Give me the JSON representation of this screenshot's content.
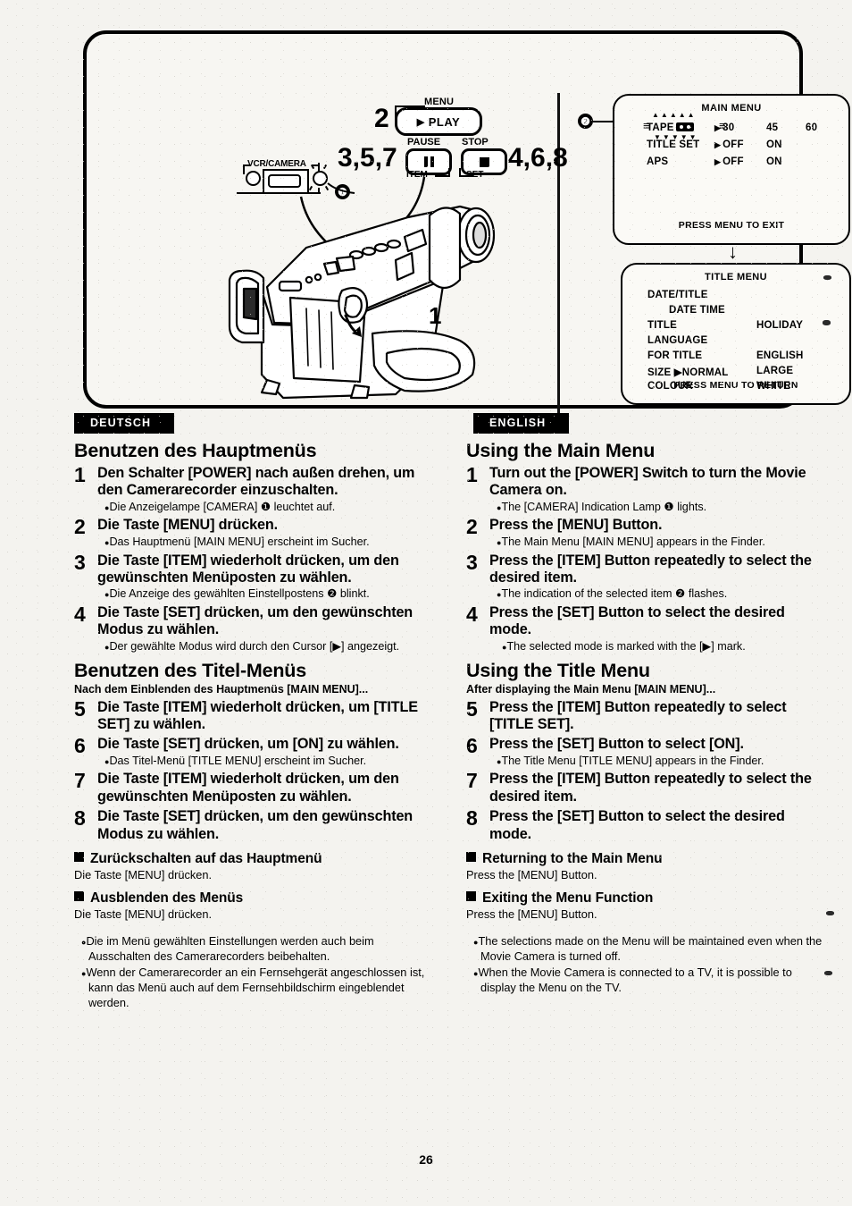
{
  "page": {
    "number": "26"
  },
  "illustration": {
    "callouts": {
      "one": "❶",
      "two": "❷",
      "camera_step": "1"
    },
    "buttons": {
      "menu_label": "MENU",
      "play_label": "PLAY",
      "play_cursor": "▶",
      "pause_label": "PAUSE",
      "stop_label": "STOP",
      "item_label": "ITEM",
      "set_label": "SET",
      "vcr_camera_label": "VCR/CAMERA"
    },
    "step_numbers": {
      "two": "2",
      "three_five_seven": "3,5,7",
      "four_six_eight": "4,6,8"
    },
    "flow_arrow": "↓"
  },
  "osd": {
    "main_menu": {
      "title": "MAIN MENU",
      "blink_top": "▲▲▲▲▲",
      "blink_bottom": "▼▼▼▼▼",
      "rows": [
        {
          "name": "TAPE",
          "has_tape_icon": true,
          "cursor": "▶",
          "v1": "30",
          "v2": "45",
          "v3": "60"
        },
        {
          "name": "TITLE SET",
          "has_tape_icon": false,
          "cursor": "▶",
          "v1": "OFF",
          "v2": "ON",
          "v3": ""
        },
        {
          "name": "APS",
          "has_tape_icon": false,
          "cursor": "▶",
          "v1": "OFF",
          "v2": "ON",
          "v3": ""
        }
      ],
      "footer": "PRESS MENU TO EXIT"
    },
    "title_menu": {
      "title": "TITLE MENU",
      "rows": [
        {
          "left": "DATE/TITLE",
          "right": ""
        },
        {
          "left": "DATE  TIME",
          "right": "",
          "indent": true
        },
        {
          "left": "TITLE",
          "right": "HOLIDAY"
        },
        {
          "left": "LANGUAGE",
          "right": ""
        },
        {
          "left": "FOR TITLE",
          "right": "ENGLISH"
        },
        {
          "left": "SIZE   ▶NORMAL",
          "right": "LARGE"
        },
        {
          "left": "COLOUR",
          "right": "WHITE"
        }
      ],
      "footer": "PRESS MENU TO RETURN"
    }
  },
  "german": {
    "tag": "DEUTSCH",
    "section1_title": "Benutzen des Hauptmenüs",
    "steps1": [
      {
        "num": "1",
        "text": "Den Schalter [POWER] nach außen drehen, um den Camerarecorder einzuschalten.",
        "bullets": [
          "Die Anzeigelampe [CAMERA] ❶ leuchtet auf."
        ]
      },
      {
        "num": "2",
        "text": "Die Taste [MENU] drücken.",
        "bullets": [
          "Das Hauptmenü [MAIN MENU] erscheint im Sucher."
        ]
      },
      {
        "num": "3",
        "text": "Die Taste [ITEM] wiederholt drücken, um den gewünschten Menüposten zu wählen.",
        "bullets": [
          "Die Anzeige des gewählten Einstellpostens ❷ blinkt."
        ]
      },
      {
        "num": "4",
        "text": "Die Taste [SET] drücken, um den gewünschten Modus zu wählen.",
        "bullets": [
          "Der gewählte Modus wird durch den Cursor [▶] angezeigt."
        ]
      }
    ],
    "section2_title": "Benutzen des Titel-Menüs",
    "section2_note": "Nach dem Einblenden des Hauptmenüs [MAIN MENU]...",
    "steps2": [
      {
        "num": "5",
        "text": "Die Taste [ITEM] wiederholt drücken, um [TITLE SET] zu wählen.",
        "bullets": []
      },
      {
        "num": "6",
        "text": "Die Taste [SET] drücken, um [ON] zu wählen.",
        "bullets": [
          "Das Titel-Menü [TITLE MENU] erscheint im Sucher."
        ]
      },
      {
        "num": "7",
        "text": "Die Taste [ITEM] wiederholt drücken, um den gewünschten Menüposten zu wählen.",
        "bullets": []
      },
      {
        "num": "8",
        "text": "Die Taste [SET] drücken, um den gewünschten Modus zu wählen.",
        "bullets": []
      }
    ],
    "sub1_head": "Zurückschalten auf das Hauptmenü",
    "sub1_text": "Die Taste [MENU] drücken.",
    "sub2_head": "Ausblenden des Menüs",
    "sub2_text": "Die Taste [MENU] drücken.",
    "tail": [
      "Die im Menü gewählten Einstellungen werden auch beim Ausschalten des Camerarecorders beibehalten.",
      "Wenn der Camerarecorder an ein Fernsehgerät angeschlossen ist, kann das Menü auch auf dem Fernsehbildschirm eingeblendet werden."
    ]
  },
  "english": {
    "tag": "ENGLISH",
    "section1_title": "Using the Main Menu",
    "steps1": [
      {
        "num": "1",
        "text": "Turn out the [POWER] Switch to turn the Movie Camera on.",
        "bullets": [
          "The [CAMERA] Indication Lamp ❶ lights."
        ]
      },
      {
        "num": "2",
        "text": "Press the [MENU] Button.",
        "bullets": [
          "The Main Menu [MAIN MENU] appears in the Finder."
        ]
      },
      {
        "num": "3",
        "text": "Press the [ITEM] Button repeatedly to select the desired item.",
        "bullets": [
          "The indication of the selected item ❷ flashes."
        ]
      },
      {
        "num": "4",
        "text": "Press the [SET] Button to select the desired mode.",
        "bullets": [
          "The selected mode is marked with the [▶] mark."
        ]
      }
    ],
    "section2_title": "Using the Title Menu",
    "section2_note": "After displaying the Main Menu [MAIN MENU]...",
    "steps2": [
      {
        "num": "5",
        "text": "Press the [ITEM] Button repeatedly to select [TITLE SET].",
        "bullets": []
      },
      {
        "num": "6",
        "text": "Press the [SET] Button to select [ON].",
        "bullets": [
          "The Title Menu [TITLE MENU] appears in the Finder."
        ]
      },
      {
        "num": "7",
        "text": "Press the [ITEM] Button repeatedly to select the desired item.",
        "bullets": []
      },
      {
        "num": "8",
        "text": "Press the [SET] Button to select the desired mode.",
        "bullets": []
      }
    ],
    "sub1_head": "Returning to the Main Menu",
    "sub1_text": "Press the [MENU] Button.",
    "sub2_head": "Exiting the Menu Function",
    "sub2_text": "Press the [MENU] Button.",
    "tail": [
      "The selections made on the Menu will be maintained even when the Movie Camera is turned off.",
      "When the Movie Camera is connected to a TV, it is possible to display the Menu on the TV."
    ]
  }
}
